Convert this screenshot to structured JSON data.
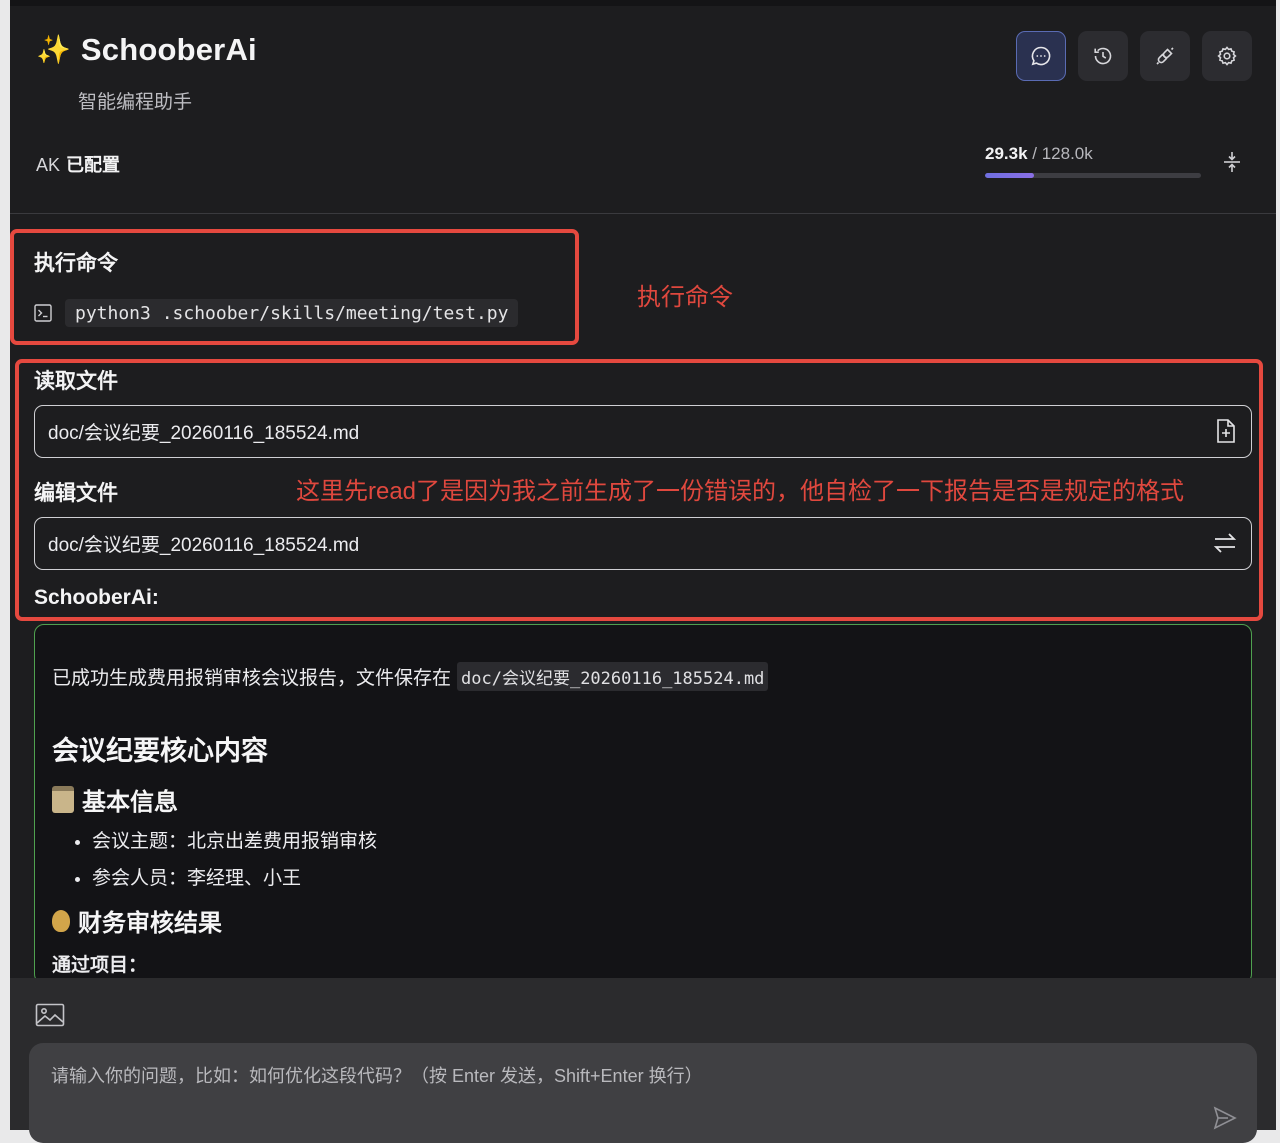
{
  "header": {
    "app_title": "SchooberAi",
    "subtitle": "智能编程助手",
    "buttons": [
      {
        "name": "chat-icon",
        "active": true
      },
      {
        "name": "history-icon",
        "active": false
      },
      {
        "name": "plug-icon",
        "active": false
      },
      {
        "name": "gear-icon",
        "active": false
      }
    ]
  },
  "status": {
    "ak_label": "AK",
    "ak_value": "已配置",
    "tokens_used": "29.3k",
    "tokens_sep": " / ",
    "tokens_total": "128.0k",
    "token_fraction": 0.229
  },
  "annotations": {
    "exec_note": "执行命令",
    "read_note": "这里先read了是因为我之前生成了一份错误的，他自检了一下报告是否是规定的格式"
  },
  "tools": {
    "exec_title": "执行命令",
    "exec_command": "python3 .schoober/skills/meeting/test.py",
    "read_title": "读取文件",
    "read_path": "doc/会议纪要_20260116_185524.md",
    "edit_title": "编辑文件",
    "edit_path": "doc/会议纪要_20260116_185524.md"
  },
  "response": {
    "label": "SchooberAi:",
    "intro": "已成功生成费用报销审核会议报告，文件保存在",
    "file_code": "doc/会议纪要_20260116_185524.md",
    "heading": "会议纪要核心内容",
    "section1_title": "基本信息",
    "section1_items": [
      "会议主题：北京出差费用报销审核",
      "参会人员：李经理、小王"
    ],
    "section2_title": "财务审核结果",
    "cut_text": "通过项目："
  },
  "composer": {
    "placeholder": "请输入你的问题，比如：如何优化这段代码？（按 Enter 发送，Shift+Enter 换行）"
  }
}
